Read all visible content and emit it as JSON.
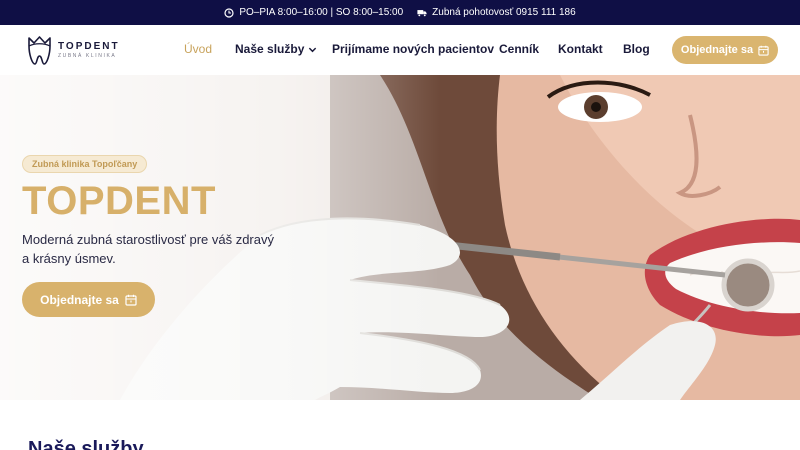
{
  "topbar": {
    "hours": "PO–PIA 8:00–16:00 | SO 8:00–15:00",
    "emergency": "Zubná pohotovosť 0915 111 186",
    "clock_icon": "clock-icon",
    "truck_icon": "truck-icon"
  },
  "header": {
    "logo_name": "TOPDENT",
    "logo_sub": "ZUBNÁ KLINIKA",
    "nav": [
      {
        "label": "Úvod",
        "active": true
      },
      {
        "label": "Naše služby",
        "dropdown": true
      },
      {
        "label": "Prijímame nových pacientov"
      },
      {
        "label": "Cenník"
      },
      {
        "label": "Kontakt"
      },
      {
        "label": "Blog"
      }
    ],
    "cta_label": "Objednajte sa",
    "cta_icon": "calendar-icon"
  },
  "hero": {
    "badge": "Zubná klinika Topoľčany",
    "title": "TOPDENT",
    "description": "Moderná zubná starostlivosť pre váš zdravý a krásny úsmev.",
    "cta_label": "Objednajte sa",
    "cta_icon": "calendar-icon"
  },
  "services": {
    "title": "Naše služby"
  },
  "colors": {
    "topbar_bg": "#0f0f45",
    "accent_gold": "#d8b26c",
    "nav_text": "#1a1a3a"
  }
}
